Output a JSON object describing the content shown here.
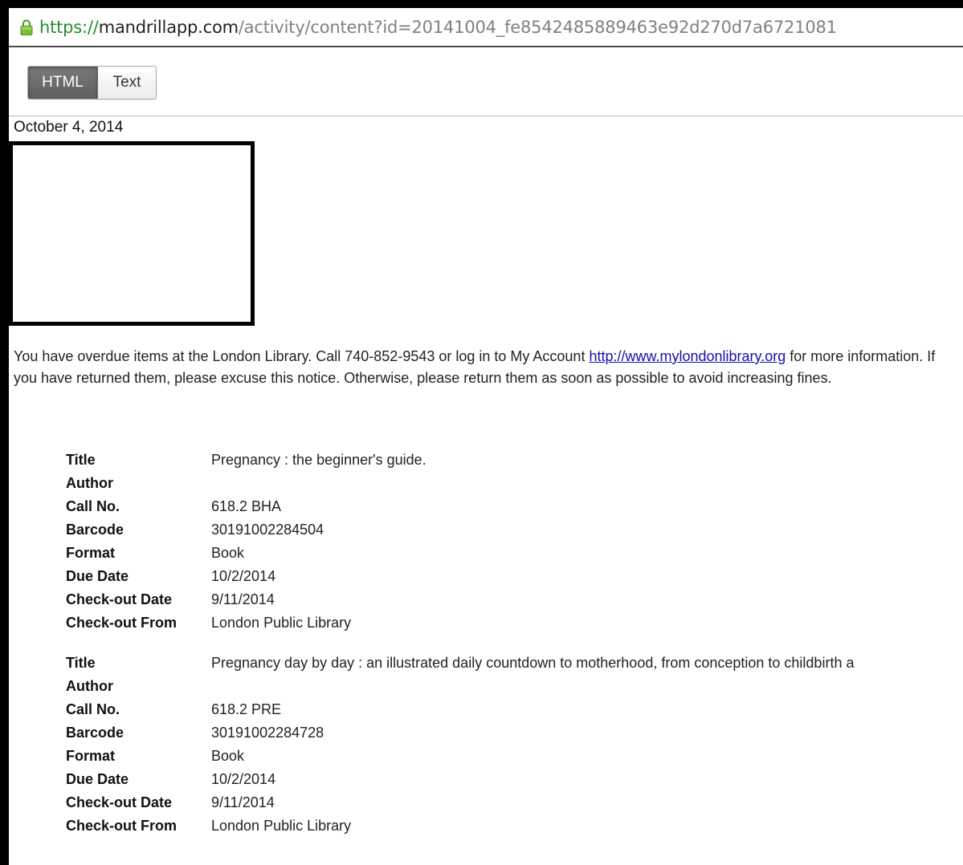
{
  "browser": {
    "url_scheme": "https://",
    "url_host": "mandrillapp.com",
    "url_path": "/activity/content?id=20141004_fe8542485889463e92d270d7a6721081"
  },
  "toolbar": {
    "html_label": "HTML",
    "text_label": "Text",
    "selected": "HTML"
  },
  "email": {
    "date": "October 4, 2014",
    "notice_before_link": "You have overdue items at the London Library. Call 740-852-9543 or log in to My Account ",
    "notice_link": "http://www.mylondonlibrary.org",
    "notice_after_link": " for more information. If you have returned them, please excuse this notice.  Otherwise, please return them as soon as possible to avoid increasing fines.",
    "field_labels": {
      "title": "Title",
      "author": "Author",
      "call_no": "Call No.",
      "barcode": "Barcode",
      "format": "Format",
      "due_date": "Due Date",
      "checkout_date": "Check-out Date",
      "checkout_from": "Check-out From"
    },
    "items": [
      {
        "title": "Pregnancy : the beginner's guide.",
        "author": "",
        "call_no": "618.2 BHA",
        "barcode": "30191002284504",
        "format": "Book",
        "due_date": "10/2/2014",
        "checkout_date": "9/11/2014",
        "checkout_from": "London Public Library"
      },
      {
        "title": "Pregnancy day by day : an illustrated daily countdown to motherhood, from conception to childbirth a",
        "author": "",
        "call_no": "618.2 PRE",
        "barcode": "30191002284728",
        "format": "Book",
        "due_date": "10/2/2014",
        "checkout_date": "9/11/2014",
        "checkout_from": "London Public Library"
      }
    ]
  }
}
